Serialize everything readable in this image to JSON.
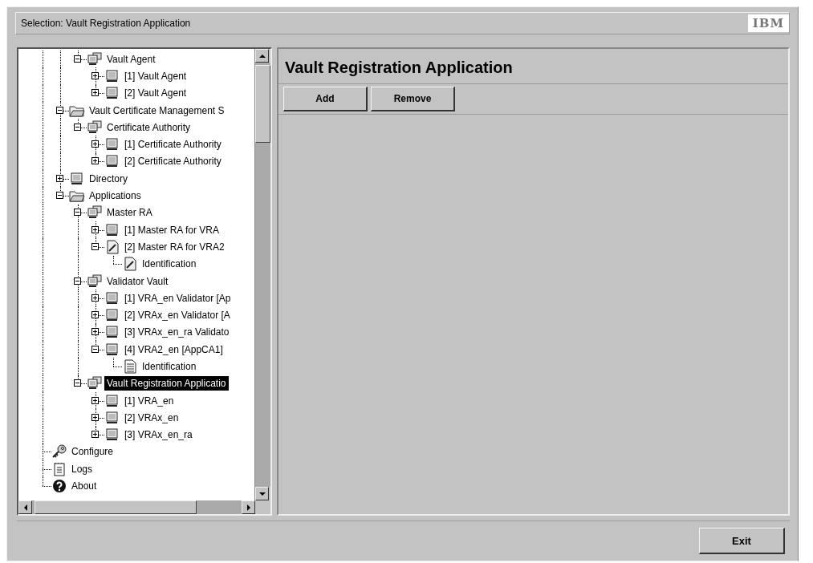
{
  "header": {
    "selection": "Selection: Vault Registration Application",
    "logo": "IBM"
  },
  "tree": {
    "cut_branch": [
      {
        "label": "Vault Agent",
        "kind": "group",
        "expanded": true,
        "selected": false,
        "children": [
          {
            "label": "[1] Vault Agent",
            "kind": "computer",
            "expanded": false,
            "selected": false
          },
          {
            "label": "[2] Vault Agent",
            "kind": "computer",
            "expanded": false,
            "selected": false
          }
        ]
      }
    ],
    "branch": [
      {
        "label": "Vault Certificate Management S",
        "kind": "folder",
        "expanded": true,
        "selected": false,
        "children": [
          {
            "label": "Certificate Authority",
            "kind": "group",
            "expanded": true,
            "selected": false,
            "children": [
              {
                "label": "[1] Certificate Authority",
                "kind": "computer",
                "expanded": false,
                "selected": false
              },
              {
                "label": "[2] Certificate Authority",
                "kind": "computer",
                "expanded": false,
                "selected": false
              }
            ]
          }
        ]
      },
      {
        "label": "Directory",
        "kind": "computer",
        "expanded": false,
        "selected": false
      },
      {
        "label": "Applications",
        "kind": "folder",
        "expanded": true,
        "selected": false,
        "children": [
          {
            "label": "Master RA",
            "kind": "group",
            "expanded": true,
            "selected": false,
            "children": [
              {
                "label": "[1] Master RA for VRA",
                "kind": "computer",
                "expanded": false,
                "selected": false
              },
              {
                "label": "[2] Master RA for VRA2",
                "kind": "edit",
                "expanded": true,
                "selected": false,
                "children": [
                  {
                    "label": "Identification",
                    "kind": "edit",
                    "selected": false
                  }
                ]
              }
            ]
          },
          {
            "label": "Validator Vault",
            "kind": "group",
            "expanded": true,
            "selected": false,
            "children": [
              {
                "label": "[1] VRA_en Validator [Ap",
                "kind": "computer",
                "expanded": false,
                "selected": false
              },
              {
                "label": "[2] VRAx_en Validator [A",
                "kind": "computer",
                "expanded": false,
                "selected": false
              },
              {
                "label": "[3] VRAx_en_ra Validato",
                "kind": "computer",
                "expanded": false,
                "selected": false
              },
              {
                "label": "[4] VRA2_en [AppCA1]",
                "kind": "computer",
                "expanded": true,
                "selected": false,
                "children": [
                  {
                    "label": "Identification",
                    "kind": "doc",
                    "selected": false
                  }
                ]
              }
            ]
          },
          {
            "label": "Vault Registration Applicatio",
            "kind": "group",
            "expanded": true,
            "selected": true,
            "children": [
              {
                "label": "[1] VRA_en",
                "kind": "computer",
                "expanded": false,
                "selected": false
              },
              {
                "label": "[2] VRAx_en",
                "kind": "computer",
                "expanded": false,
                "selected": false
              },
              {
                "label": "[3] VRAx_en_ra",
                "kind": "computer",
                "expanded": false,
                "selected": false
              }
            ]
          }
        ]
      }
    ],
    "roots": [
      {
        "label": "Configure",
        "kind": "key",
        "selected": false
      },
      {
        "label": "Logs",
        "kind": "log",
        "selected": false
      },
      {
        "label": "About",
        "kind": "help",
        "selected": false
      }
    ]
  },
  "panel": {
    "title": "Vault Registration Application",
    "buttons": [
      "Add",
      "Remove"
    ]
  },
  "footer": {
    "button": "Exit"
  }
}
